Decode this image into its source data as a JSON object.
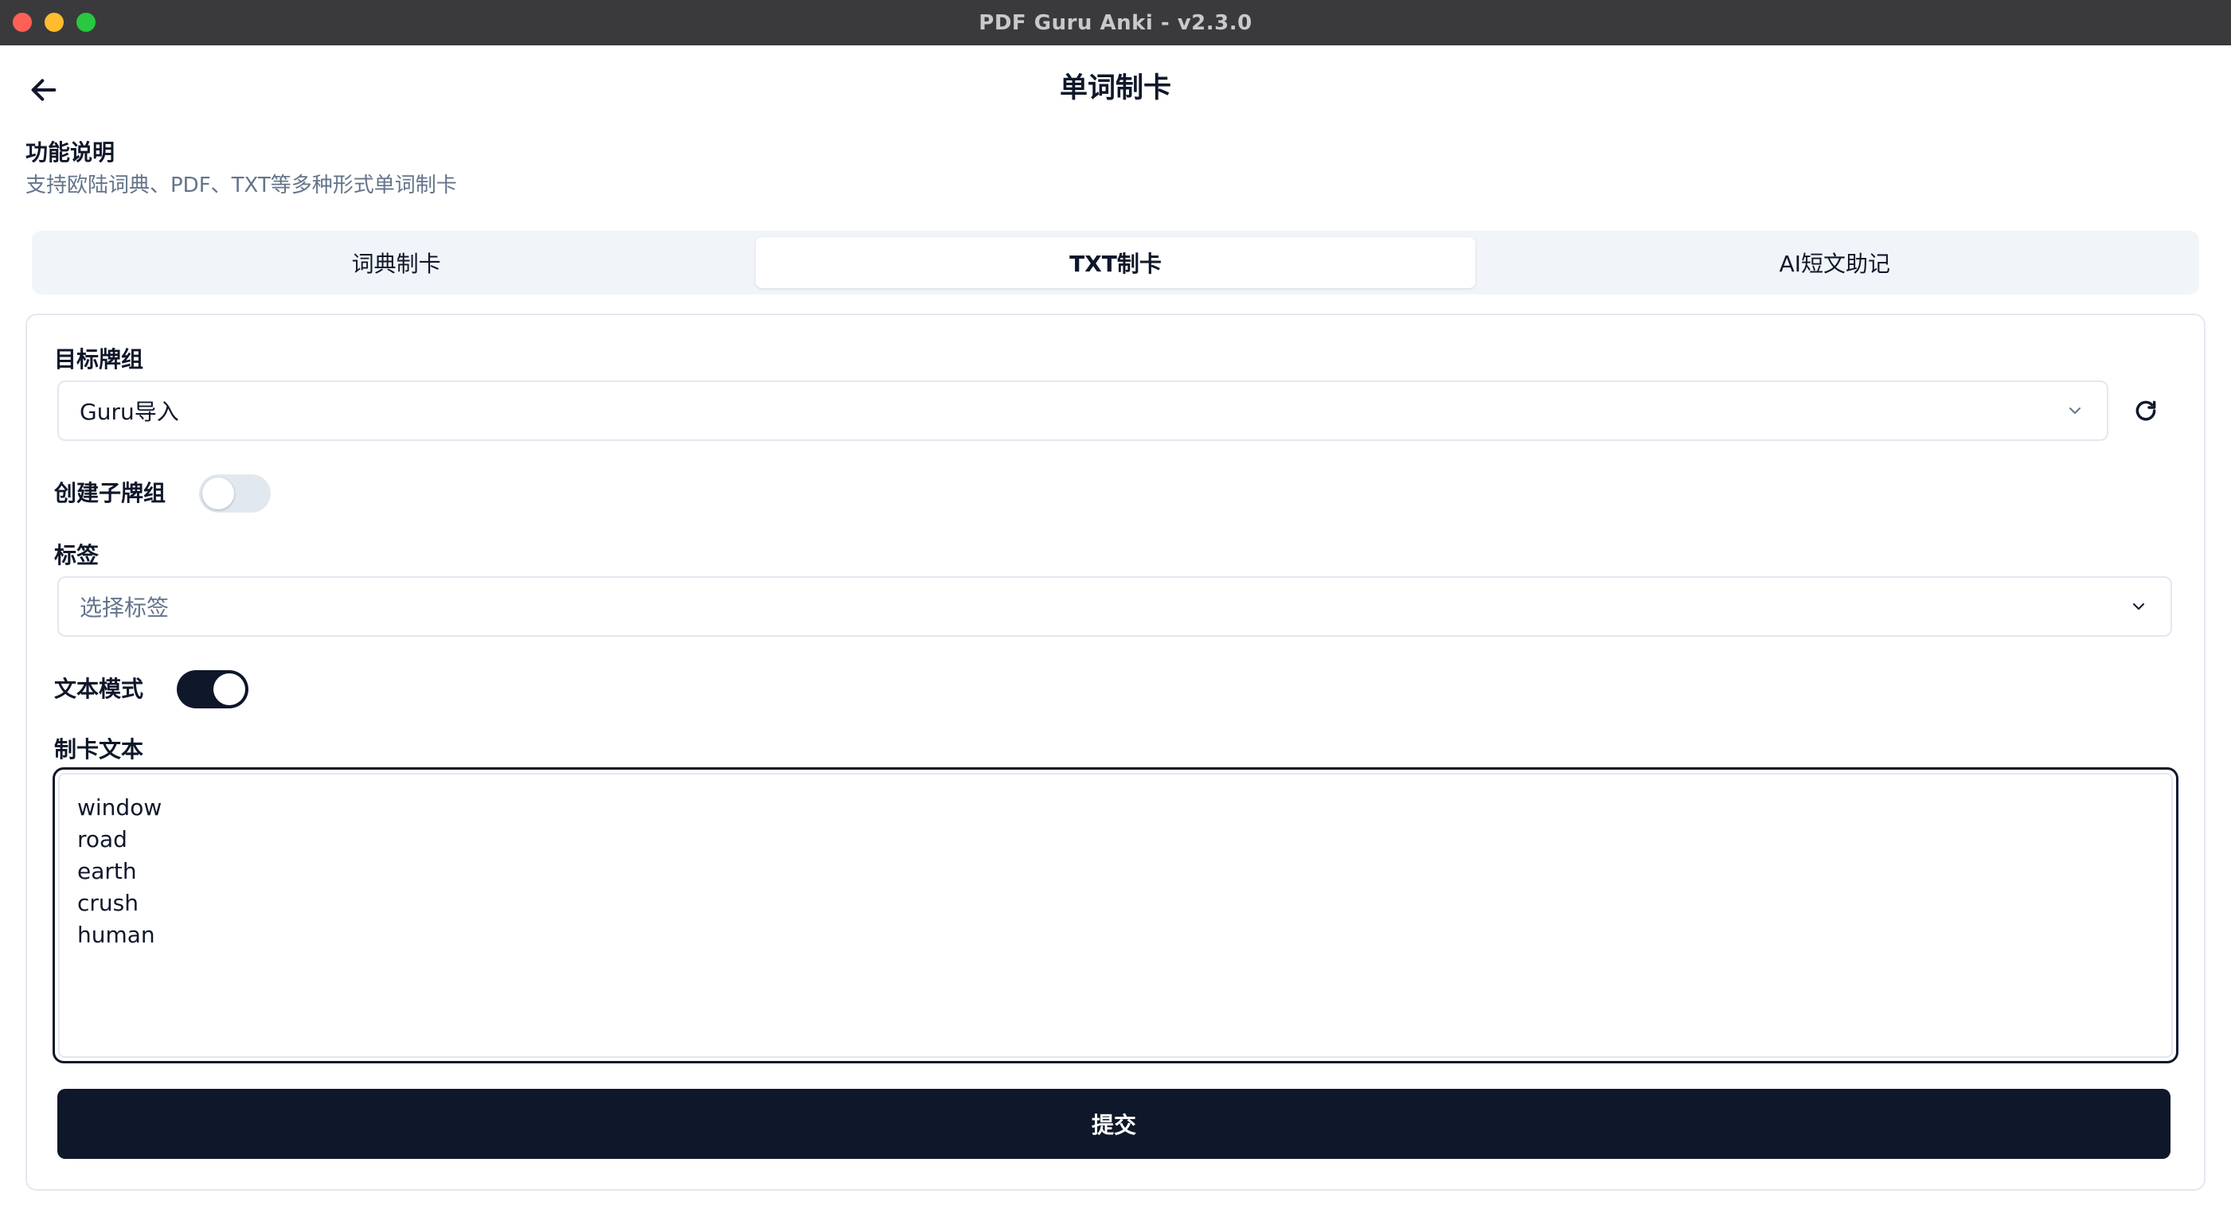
{
  "window": {
    "title": "PDF Guru Anki - v2.3.0"
  },
  "header": {
    "back_icon": "arrow-left-icon",
    "title": "单词制卡"
  },
  "description": {
    "title": "功能说明",
    "text": "支持欧陆词典、PDF、TXT等多种形式单词制卡"
  },
  "tabs": [
    {
      "label": "词典制卡",
      "active": false
    },
    {
      "label": "TXT制卡",
      "active": true
    },
    {
      "label": "AI短文助记",
      "active": false
    }
  ],
  "form": {
    "target_deck": {
      "label": "目标牌组",
      "value": "Guru导入",
      "refresh_icon": "refresh-icon"
    },
    "create_subdeck": {
      "label": "创建子牌组",
      "enabled": false
    },
    "tags": {
      "label": "标签",
      "placeholder": "选择标签"
    },
    "text_mode": {
      "label": "文本模式",
      "enabled": true
    },
    "card_text": {
      "label": "制卡文本",
      "lines": [
        "window",
        "road",
        "earth",
        "crush",
        "human"
      ]
    },
    "submit_label": "提交"
  },
  "colors": {
    "primary": "#0f172a",
    "muted_text": "#64748b",
    "border": "#e2e8f0",
    "tab_bg": "#f1f5f9",
    "titlebar": "#3a3a3c"
  }
}
